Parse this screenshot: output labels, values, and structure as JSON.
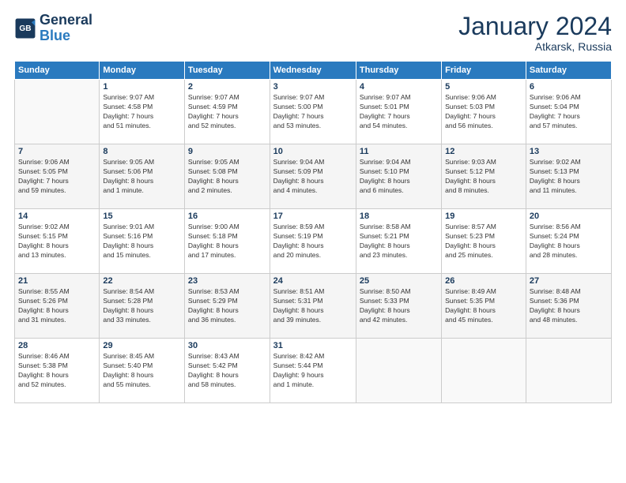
{
  "header": {
    "logo_line1": "General",
    "logo_line2": "Blue",
    "month": "January 2024",
    "location": "Atkarsk, Russia"
  },
  "weekdays": [
    "Sunday",
    "Monday",
    "Tuesday",
    "Wednesday",
    "Thursday",
    "Friday",
    "Saturday"
  ],
  "weeks": [
    [
      {
        "day": "",
        "info": ""
      },
      {
        "day": "1",
        "info": "Sunrise: 9:07 AM\nSunset: 4:58 PM\nDaylight: 7 hours\nand 51 minutes."
      },
      {
        "day": "2",
        "info": "Sunrise: 9:07 AM\nSunset: 4:59 PM\nDaylight: 7 hours\nand 52 minutes."
      },
      {
        "day": "3",
        "info": "Sunrise: 9:07 AM\nSunset: 5:00 PM\nDaylight: 7 hours\nand 53 minutes."
      },
      {
        "day": "4",
        "info": "Sunrise: 9:07 AM\nSunset: 5:01 PM\nDaylight: 7 hours\nand 54 minutes."
      },
      {
        "day": "5",
        "info": "Sunrise: 9:06 AM\nSunset: 5:03 PM\nDaylight: 7 hours\nand 56 minutes."
      },
      {
        "day": "6",
        "info": "Sunrise: 9:06 AM\nSunset: 5:04 PM\nDaylight: 7 hours\nand 57 minutes."
      }
    ],
    [
      {
        "day": "7",
        "info": "Sunrise: 9:06 AM\nSunset: 5:05 PM\nDaylight: 7 hours\nand 59 minutes."
      },
      {
        "day": "8",
        "info": "Sunrise: 9:05 AM\nSunset: 5:06 PM\nDaylight: 8 hours\nand 1 minute."
      },
      {
        "day": "9",
        "info": "Sunrise: 9:05 AM\nSunset: 5:08 PM\nDaylight: 8 hours\nand 2 minutes."
      },
      {
        "day": "10",
        "info": "Sunrise: 9:04 AM\nSunset: 5:09 PM\nDaylight: 8 hours\nand 4 minutes."
      },
      {
        "day": "11",
        "info": "Sunrise: 9:04 AM\nSunset: 5:10 PM\nDaylight: 8 hours\nand 6 minutes."
      },
      {
        "day": "12",
        "info": "Sunrise: 9:03 AM\nSunset: 5:12 PM\nDaylight: 8 hours\nand 8 minutes."
      },
      {
        "day": "13",
        "info": "Sunrise: 9:02 AM\nSunset: 5:13 PM\nDaylight: 8 hours\nand 11 minutes."
      }
    ],
    [
      {
        "day": "14",
        "info": "Sunrise: 9:02 AM\nSunset: 5:15 PM\nDaylight: 8 hours\nand 13 minutes."
      },
      {
        "day": "15",
        "info": "Sunrise: 9:01 AM\nSunset: 5:16 PM\nDaylight: 8 hours\nand 15 minutes."
      },
      {
        "day": "16",
        "info": "Sunrise: 9:00 AM\nSunset: 5:18 PM\nDaylight: 8 hours\nand 17 minutes."
      },
      {
        "day": "17",
        "info": "Sunrise: 8:59 AM\nSunset: 5:19 PM\nDaylight: 8 hours\nand 20 minutes."
      },
      {
        "day": "18",
        "info": "Sunrise: 8:58 AM\nSunset: 5:21 PM\nDaylight: 8 hours\nand 23 minutes."
      },
      {
        "day": "19",
        "info": "Sunrise: 8:57 AM\nSunset: 5:23 PM\nDaylight: 8 hours\nand 25 minutes."
      },
      {
        "day": "20",
        "info": "Sunrise: 8:56 AM\nSunset: 5:24 PM\nDaylight: 8 hours\nand 28 minutes."
      }
    ],
    [
      {
        "day": "21",
        "info": "Sunrise: 8:55 AM\nSunset: 5:26 PM\nDaylight: 8 hours\nand 31 minutes."
      },
      {
        "day": "22",
        "info": "Sunrise: 8:54 AM\nSunset: 5:28 PM\nDaylight: 8 hours\nand 33 minutes."
      },
      {
        "day": "23",
        "info": "Sunrise: 8:53 AM\nSunset: 5:29 PM\nDaylight: 8 hours\nand 36 minutes."
      },
      {
        "day": "24",
        "info": "Sunrise: 8:51 AM\nSunset: 5:31 PM\nDaylight: 8 hours\nand 39 minutes."
      },
      {
        "day": "25",
        "info": "Sunrise: 8:50 AM\nSunset: 5:33 PM\nDaylight: 8 hours\nand 42 minutes."
      },
      {
        "day": "26",
        "info": "Sunrise: 8:49 AM\nSunset: 5:35 PM\nDaylight: 8 hours\nand 45 minutes."
      },
      {
        "day": "27",
        "info": "Sunrise: 8:48 AM\nSunset: 5:36 PM\nDaylight: 8 hours\nand 48 minutes."
      }
    ],
    [
      {
        "day": "28",
        "info": "Sunrise: 8:46 AM\nSunset: 5:38 PM\nDaylight: 8 hours\nand 52 minutes."
      },
      {
        "day": "29",
        "info": "Sunrise: 8:45 AM\nSunset: 5:40 PM\nDaylight: 8 hours\nand 55 minutes."
      },
      {
        "day": "30",
        "info": "Sunrise: 8:43 AM\nSunset: 5:42 PM\nDaylight: 8 hours\nand 58 minutes."
      },
      {
        "day": "31",
        "info": "Sunrise: 8:42 AM\nSunset: 5:44 PM\nDaylight: 9 hours\nand 1 minute."
      },
      {
        "day": "",
        "info": ""
      },
      {
        "day": "",
        "info": ""
      },
      {
        "day": "",
        "info": ""
      }
    ]
  ]
}
